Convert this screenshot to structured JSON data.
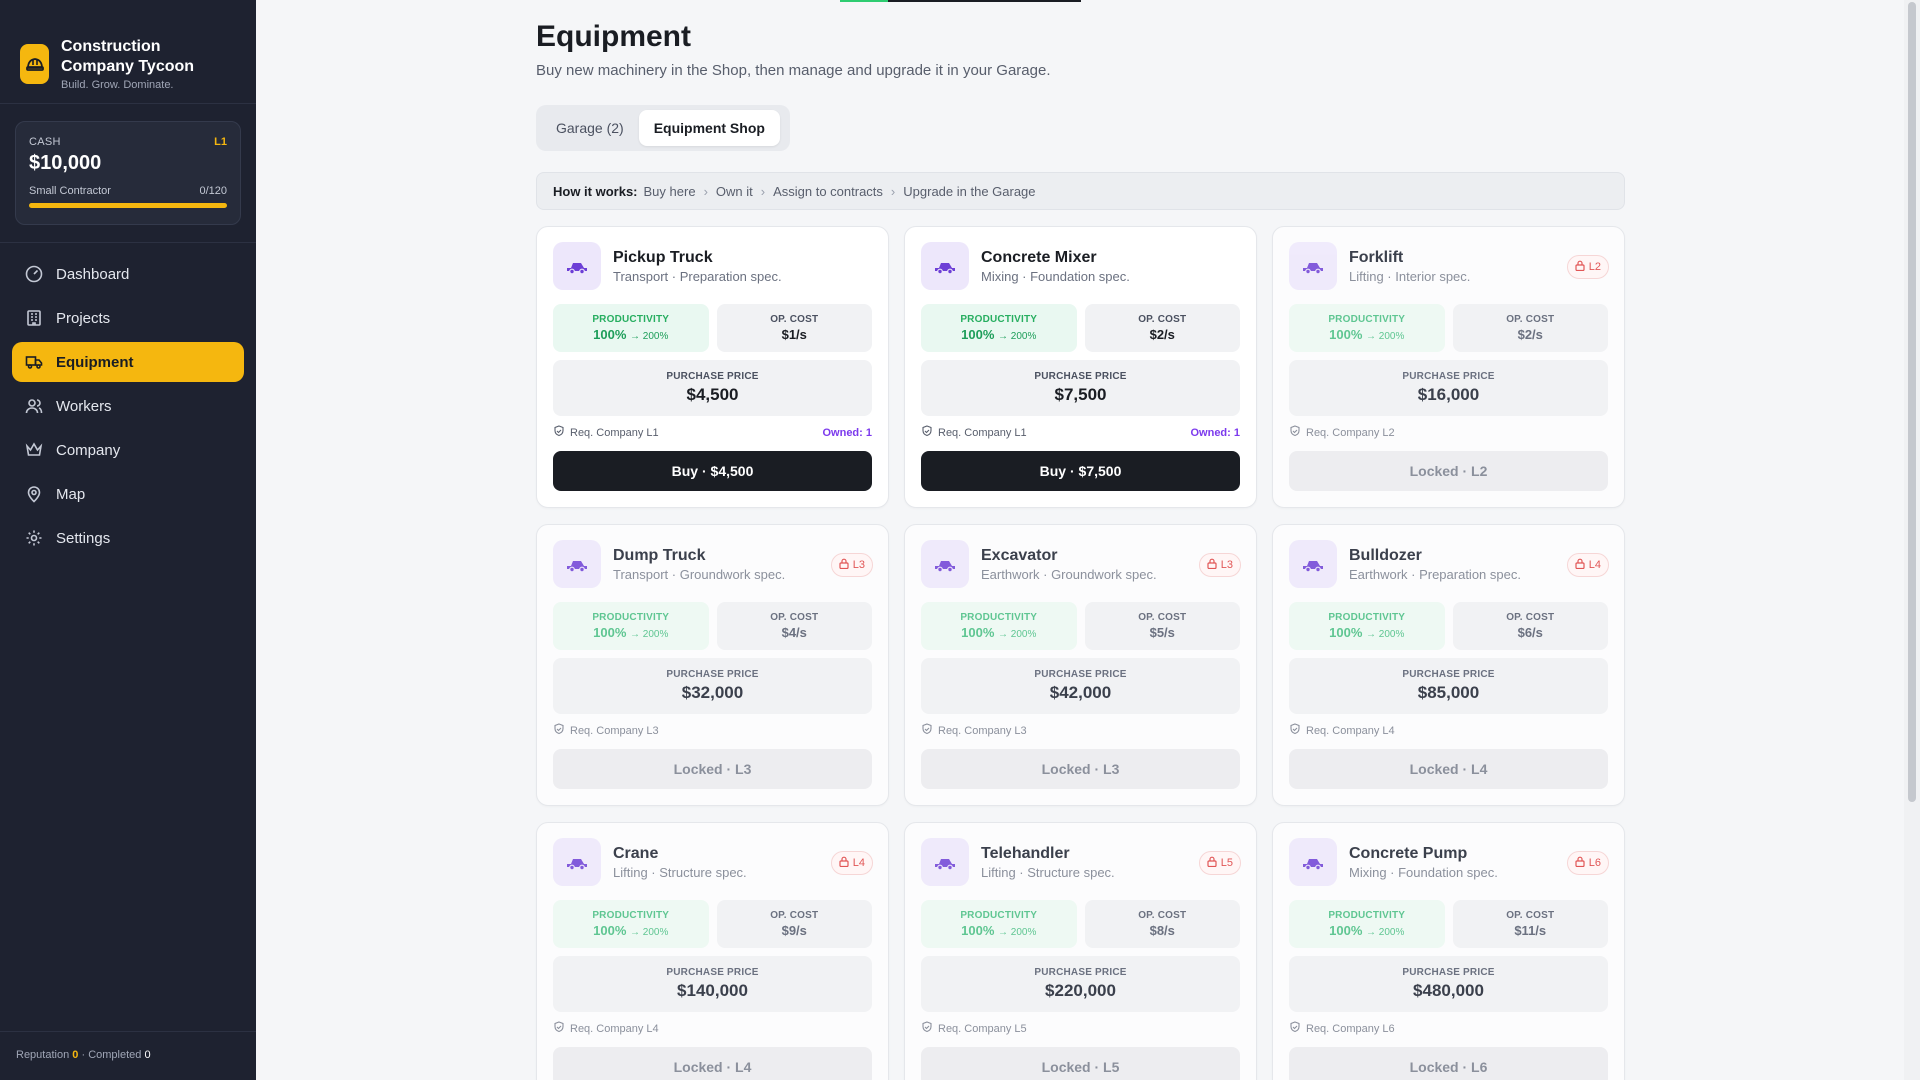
{
  "brand": {
    "title": "Construction Company Tycoon",
    "tagline": "Build. Grow. Dominate."
  },
  "cash": {
    "label": "CASH",
    "level": "L1",
    "value": "$10,000",
    "tier": "Small Contractor",
    "progress": "0/120"
  },
  "nav": [
    {
      "label": "Dashboard",
      "icon": "gauge-icon"
    },
    {
      "label": "Projects",
      "icon": "building-icon"
    },
    {
      "label": "Equipment",
      "icon": "truck-icon",
      "active": true
    },
    {
      "label": "Workers",
      "icon": "users-icon"
    },
    {
      "label": "Company",
      "icon": "crown-icon"
    },
    {
      "label": "Map",
      "icon": "map-pin-icon"
    },
    {
      "label": "Settings",
      "icon": "gear-icon"
    }
  ],
  "footer": {
    "reputation_label": "Reputation",
    "reputation": "0",
    "completed_label": "Completed",
    "completed": "0"
  },
  "page": {
    "title": "Equipment",
    "description": "Buy new machinery in the Shop, then manage and upgrade it in your Garage."
  },
  "tabs": [
    {
      "label": "Garage (2)"
    },
    {
      "label": "Equipment Shop",
      "active": true
    }
  ],
  "how": {
    "label": "How it works:",
    "steps": [
      "Buy here",
      "Own it",
      "Assign to contracts",
      "Upgrade in the Garage"
    ]
  },
  "labels": {
    "productivity": "PRODUCTIVITY",
    "op_cost": "OP. COST",
    "purchase_price": "PURCHASE PRICE"
  },
  "equipment": [
    {
      "name": "Pickup Truck",
      "spec": "Transport · Preparation spec.",
      "prod": "100%",
      "prod_max": "→ 200%",
      "op_cost": "$1/s",
      "price": "$4,500",
      "req": "Req. Company L1",
      "owned": "Owned: 1",
      "action": "Buy · $4,500",
      "locked": false,
      "icon": "pickup-truck-icon"
    },
    {
      "name": "Concrete Mixer",
      "spec": "Mixing · Foundation spec.",
      "prod": "100%",
      "prod_max": "→ 200%",
      "op_cost": "$2/s",
      "price": "$7,500",
      "req": "Req. Company L1",
      "owned": "Owned: 1",
      "action": "Buy · $7,500",
      "locked": false,
      "icon": "concrete-mixer-icon"
    },
    {
      "name": "Forklift",
      "spec": "Lifting · Interior spec.",
      "badge": "L2",
      "prod": "100%",
      "prod_max": "→ 200%",
      "op_cost": "$2/s",
      "price": "$16,000",
      "req": "Req. Company L2",
      "action": "Locked · L2",
      "locked": true,
      "icon": "forklift-icon"
    },
    {
      "name": "Dump Truck",
      "spec": "Transport · Groundwork spec.",
      "badge": "L3",
      "prod": "100%",
      "prod_max": "→ 200%",
      "op_cost": "$4/s",
      "price": "$32,000",
      "req": "Req. Company L3",
      "action": "Locked · L3",
      "locked": true,
      "icon": "dump-truck-icon"
    },
    {
      "name": "Excavator",
      "spec": "Earthwork · Groundwork spec.",
      "badge": "L3",
      "prod": "100%",
      "prod_max": "→ 200%",
      "op_cost": "$5/s",
      "price": "$42,000",
      "req": "Req. Company L3",
      "action": "Locked · L3",
      "locked": true,
      "icon": "excavator-icon"
    },
    {
      "name": "Bulldozer",
      "spec": "Earthwork · Preparation spec.",
      "badge": "L4",
      "prod": "100%",
      "prod_max": "→ 200%",
      "op_cost": "$6/s",
      "price": "$85,000",
      "req": "Req. Company L4",
      "action": "Locked · L4",
      "locked": true,
      "icon": "bulldozer-icon"
    },
    {
      "name": "Crane",
      "spec": "Lifting · Structure spec.",
      "badge": "L4",
      "prod": "100%",
      "prod_max": "→ 200%",
      "op_cost": "$9/s",
      "price": "$140,000",
      "req": "Req. Company L4",
      "action": "Locked · L4",
      "locked": true,
      "icon": "crane-icon"
    },
    {
      "name": "Telehandler",
      "spec": "Lifting · Structure spec.",
      "badge": "L5",
      "prod": "100%",
      "prod_max": "→ 200%",
      "op_cost": "$8/s",
      "price": "$220,000",
      "req": "Req. Company L5",
      "action": "Locked · L5",
      "locked": true,
      "icon": "telehandler-icon"
    },
    {
      "name": "Concrete Pump",
      "spec": "Mixing · Foundation spec.",
      "badge": "L6",
      "prod": "100%",
      "prod_max": "→ 200%",
      "op_cost": "$11/s",
      "price": "$480,000",
      "req": "Req. Company L6",
      "action": "Locked · L6",
      "locked": true,
      "icon": "concrete-pump-icon"
    }
  ]
}
